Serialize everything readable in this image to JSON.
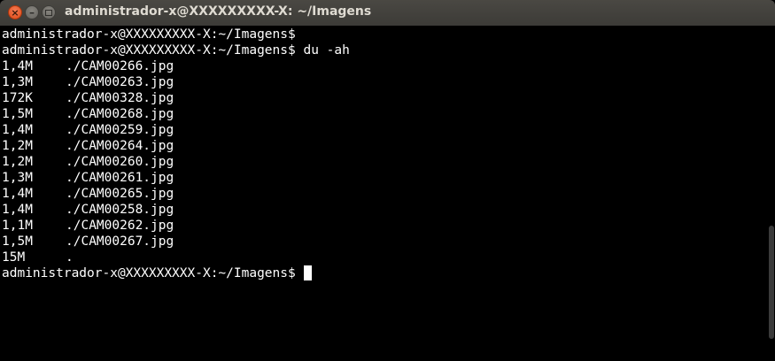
{
  "window": {
    "title": "administrador-x@XXXXXXXXX-X: ~/Imagens",
    "controls": {
      "close": "×",
      "minimize": "–",
      "maximize_icon": "maximize-icon"
    }
  },
  "terminal": {
    "prompt": "administrador-x@XXXXXXXXX-X:~/Imagens$",
    "command": "du -ah",
    "output": [
      {
        "size": "1,4M",
        "path": "./CAM00266.jpg"
      },
      {
        "size": "1,3M",
        "path": "./CAM00263.jpg"
      },
      {
        "size": "172K",
        "path": "./CAM00328.jpg"
      },
      {
        "size": "1,5M",
        "path": "./CAM00268.jpg"
      },
      {
        "size": "1,4M",
        "path": "./CAM00259.jpg"
      },
      {
        "size": "1,2M",
        "path": "./CAM00264.jpg"
      },
      {
        "size": "1,2M",
        "path": "./CAM00260.jpg"
      },
      {
        "size": "1,3M",
        "path": "./CAM00261.jpg"
      },
      {
        "size": "1,4M",
        "path": "./CAM00265.jpg"
      },
      {
        "size": "1,4M",
        "path": "./CAM00258.jpg"
      },
      {
        "size": "1,1M",
        "path": "./CAM00262.jpg"
      },
      {
        "size": "1,5M",
        "path": "./CAM00267.jpg"
      },
      {
        "size": "15M",
        "path": "."
      }
    ]
  },
  "colors": {
    "background": "#000000",
    "foreground": "#ffffff",
    "titlebar": "#3c3b37",
    "close_button": "#de4a17"
  }
}
